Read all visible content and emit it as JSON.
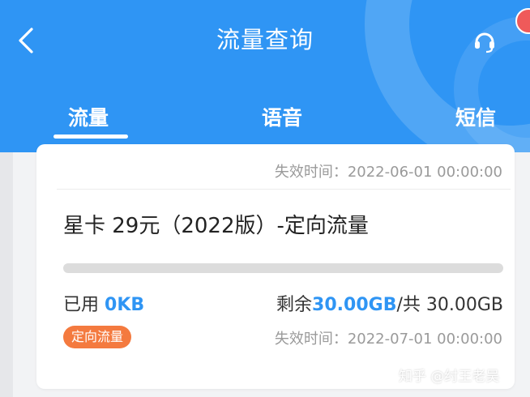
{
  "header": {
    "title": "流量查询",
    "back_icon": "chevron-left-icon",
    "service_icon": "headset-icon",
    "bg_color": "#2f95f4"
  },
  "tabs": [
    {
      "label": "流量",
      "active": true
    },
    {
      "label": "语音",
      "active": false
    },
    {
      "label": "短信",
      "active": false
    }
  ],
  "previous_card": {
    "expire": "失效时间：2022-06-01 00:00:00"
  },
  "plan": {
    "name": "星卡 29元（2022版）-定向流量",
    "used_fraction": 0,
    "used_label": "已用",
    "used_value": "0KB",
    "remain_label": "剩余",
    "remain_value": "30.00GB",
    "total_text": "/共 30.00GB",
    "tag": "定向流量",
    "tag_color": "#f47a3f",
    "expire": "失效时间：2022-07-01 00:00:00"
  },
  "watermark": "知乎 @纣王老吴"
}
